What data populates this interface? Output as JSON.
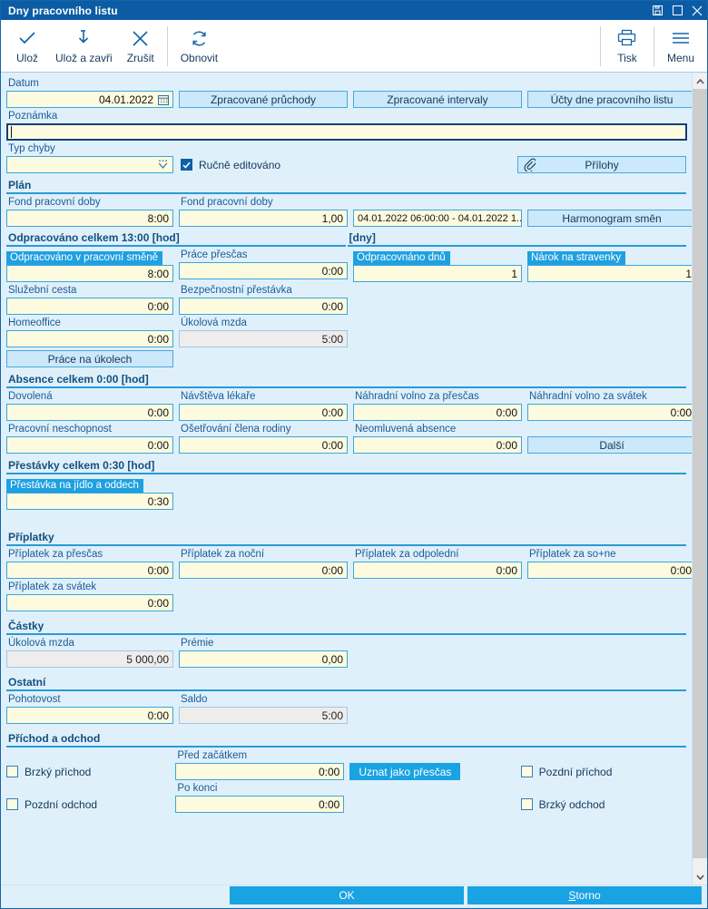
{
  "window": {
    "title": "Dny pracovního listu",
    "buttons": [
      {
        "name": "restore-icon",
        "label": "restore"
      },
      {
        "name": "maximize-icon",
        "label": "maximize"
      },
      {
        "name": "close-icon",
        "label": "close"
      }
    ]
  },
  "toolbar": {
    "left": [
      {
        "label": "Ulož",
        "icon": "check-icon"
      },
      {
        "label": "Ulož a zavři",
        "icon": "save-close-icon"
      },
      {
        "label": "Zrušit",
        "icon": "cancel-x-icon"
      }
    ],
    "refresh": {
      "label": "Obnovit",
      "icon": "refresh-icon"
    },
    "right": [
      {
        "label": "Tisk",
        "icon": "print-icon"
      },
      {
        "label": "Menu",
        "icon": "hamburger-menu-icon"
      }
    ]
  },
  "form": {
    "datum": {
      "label": "Datum",
      "value": "04.01.2022"
    },
    "poznamka": {
      "label": "Poznámka",
      "value": ""
    },
    "typ_chyby": {
      "label": "Typ chyby",
      "value": ""
    },
    "rucne_editovano": {
      "label": "Ručně editováno",
      "checked": true
    },
    "top_buttons": [
      "Zpracované průchody",
      "Zpracované intervaly",
      "Účty dne pracovního listu"
    ],
    "prilohy_button": "Přílohy"
  },
  "sections": {
    "plan": {
      "title": "Plán",
      "fond_hod": {
        "label": "Fond pracovní doby",
        "value": "8:00"
      },
      "fond_dny": {
        "label": "Fond pracovní doby",
        "value": "1,00"
      },
      "interval": {
        "value": "04.01.2022 06:00:00 - 04.01.2022 1..."
      },
      "harmonogram_button": "Harmonogram směn"
    },
    "odpracovano": {
      "title": "Odpracováno celkem 13:00 [hod]",
      "title_right": "[dny]",
      "fields": [
        {
          "label": "Odpracováno v pracovní směně",
          "value": "8:00",
          "selected": true
        },
        {
          "label": "Práce přesčas",
          "value": "0:00",
          "selected": false
        },
        {
          "label": "Odpracovnáno dnů",
          "value": "1",
          "selected": true
        },
        {
          "label": "Nárok na stravenky",
          "value": "1",
          "selected": true
        },
        {
          "label": "Služební cesta",
          "value": "0:00",
          "selected": false
        },
        {
          "label": "Bezpečnostní přestávka",
          "value": "0:00",
          "selected": false
        },
        {
          "label": "Homeoffice",
          "value": "0:00",
          "selected": false
        },
        {
          "label": "Úkolová mzda",
          "value": "5:00",
          "selected": false,
          "readonly": true
        }
      ],
      "prace_button": "Práce na úkolech"
    },
    "absence": {
      "title": "Absence celkem 0:00 [hod]",
      "fields": [
        {
          "label": "Dovolená",
          "value": "0:00"
        },
        {
          "label": "Návštěva lékaře",
          "value": "0:00"
        },
        {
          "label": "Náhradní volno za přesčas",
          "value": "0:00"
        },
        {
          "label": "Náhradní volno za svátek",
          "value": "0:00"
        },
        {
          "label": "Pracovní neschopnost",
          "value": "0:00"
        },
        {
          "label": "Ošetřování člena rodiny",
          "value": "0:00"
        },
        {
          "label": "Neomluvená absence",
          "value": "0:00"
        }
      ],
      "dalsi_button": "Další"
    },
    "prestavky": {
      "title": "Přestávky celkem 0:30 [hod]",
      "fields": [
        {
          "label": "Přestávka na jídlo a oddech",
          "value": "0:30",
          "selected": true
        }
      ]
    },
    "priplatky": {
      "title": "Příplatky",
      "fields": [
        {
          "label": "Příplatek za přesčas",
          "value": "0:00"
        },
        {
          "label": "Příplatek za noční",
          "value": "0:00"
        },
        {
          "label": "Příplatek za odpolední",
          "value": "0:00"
        },
        {
          "label": "Příplatek za so+ne",
          "value": "0:00"
        },
        {
          "label": "Příplatek za svátek",
          "value": "0:00"
        }
      ]
    },
    "castky": {
      "title": "Částky",
      "fields": [
        {
          "label": "Úkolová mzda",
          "value": "5 000,00",
          "readonly": true
        },
        {
          "label": "Prémie",
          "value": "0,00",
          "readonly": false
        }
      ]
    },
    "ostatni": {
      "title": "Ostatní",
      "fields": [
        {
          "label": "Pohotovost",
          "value": "0:00",
          "readonly": false
        },
        {
          "label": "Saldo",
          "value": "5:00",
          "readonly": true
        }
      ]
    },
    "prichod_odchod": {
      "title": "Příchod a odchod",
      "checkboxes": [
        {
          "label": "Brzký příchod",
          "checked": false
        },
        {
          "label": "Pozdní odchod",
          "checked": false
        },
        {
          "label": "Pozdní příchod",
          "checked": false
        },
        {
          "label": "Brzký odchod",
          "checked": false
        }
      ],
      "pred_zacatkem": {
        "label": "Před začátkem",
        "value": "0:00"
      },
      "po_konci": {
        "label": "Po konci",
        "value": "0:00"
      },
      "uznat_button": "Uznat jako přesčas"
    }
  },
  "footer": {
    "ok": "OK",
    "storno_prefix": "S",
    "storno_rest": "torno"
  },
  "colors": {
    "titlebar": "#0b5ca5",
    "accent": "#1aa3e2",
    "field_bg": "#fdfbdf",
    "panel_bg": "#dff0fb"
  }
}
